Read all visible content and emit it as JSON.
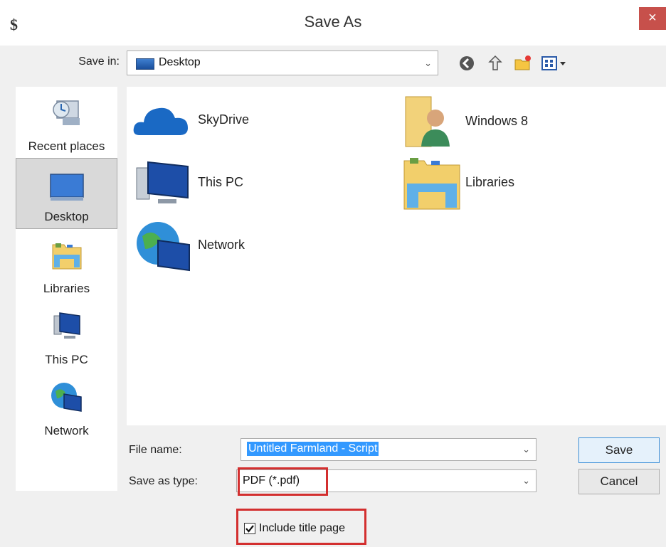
{
  "window": {
    "title": "Save As",
    "close_glyph": "×"
  },
  "save_in": {
    "label": "Save in:",
    "value": "Desktop"
  },
  "toolbar": {
    "icons": [
      "back-icon",
      "up-folder-icon",
      "new-folder-icon",
      "view-menu-icon"
    ]
  },
  "places": [
    {
      "label": "Recent places",
      "icon": "recent-places-icon",
      "selected": false
    },
    {
      "label": "Desktop",
      "icon": "desktop-icon",
      "selected": true
    },
    {
      "label": "Libraries",
      "icon": "libraries-icon",
      "selected": false
    },
    {
      "label": "This PC",
      "icon": "this-pc-icon",
      "selected": false
    },
    {
      "label": "Network",
      "icon": "network-icon",
      "selected": false
    }
  ],
  "files": [
    {
      "name": "SkyDrive",
      "icon": "skydrive-icon"
    },
    {
      "name": "Windows 8",
      "icon": "user-folder-icon"
    },
    {
      "name": "This PC",
      "icon": "this-pc-icon"
    },
    {
      "name": "Libraries",
      "icon": "libraries-icon"
    },
    {
      "name": "Network",
      "icon": "network-icon"
    }
  ],
  "file_name": {
    "label": "File name:",
    "value": "Untitled Farmland - Script"
  },
  "save_as_type": {
    "label": "Save as type:",
    "value": "PDF (*.pdf)"
  },
  "buttons": {
    "save": "Save",
    "cancel": "Cancel"
  },
  "include_title_page": {
    "label": "Include title page",
    "checked": true
  },
  "colors": {
    "highlight": "#d32f2f",
    "close_button": "#c7504b",
    "selection": "#3399ff"
  }
}
